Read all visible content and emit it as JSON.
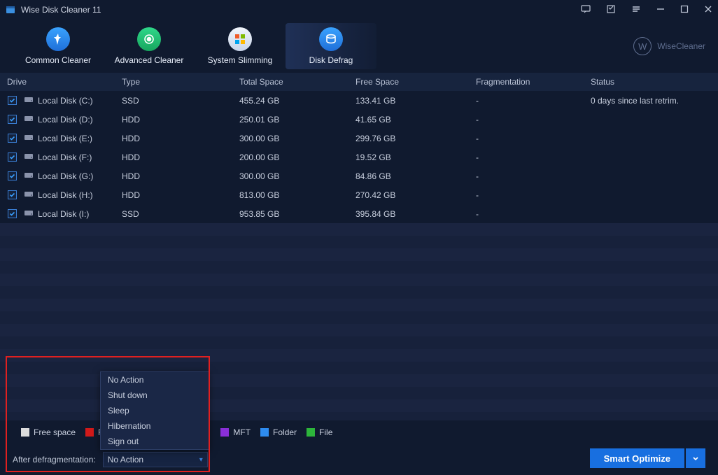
{
  "window": {
    "title": "Wise Disk Cleaner 11"
  },
  "tabs": {
    "common": "Common Cleaner",
    "advanced": "Advanced Cleaner",
    "slimming": "System Slimming",
    "defrag": "Disk Defrag"
  },
  "brand": "WiseCleaner",
  "columns": {
    "drive": "Drive",
    "type": "Type",
    "total": "Total Space",
    "free": "Free Space",
    "frag": "Fragmentation",
    "status": "Status"
  },
  "drives": [
    {
      "name": "Local Disk (C:)",
      "type": "SSD",
      "total": "455.24 GB",
      "free": "133.41 GB",
      "frag": "-",
      "status": "0 days since last retrim."
    },
    {
      "name": "Local Disk (D:)",
      "type": "HDD",
      "total": "250.01 GB",
      "free": "41.65 GB",
      "frag": "-",
      "status": ""
    },
    {
      "name": "Local Disk (E:)",
      "type": "HDD",
      "total": "300.00 GB",
      "free": "299.76 GB",
      "frag": "-",
      "status": ""
    },
    {
      "name": "Local Disk (F:)",
      "type": "HDD",
      "total": "200.00 GB",
      "free": "19.52 GB",
      "frag": "-",
      "status": ""
    },
    {
      "name": "Local Disk (G:)",
      "type": "HDD",
      "total": "300.00 GB",
      "free": "84.86 GB",
      "frag": "-",
      "status": ""
    },
    {
      "name": "Local Disk (H:)",
      "type": "HDD",
      "total": "813.00 GB",
      "free": "270.42 GB",
      "frag": "-",
      "status": ""
    },
    {
      "name": "Local Disk (I:)",
      "type": "SSD",
      "total": "953.85 GB",
      "free": "395.84 GB",
      "frag": "-",
      "status": ""
    }
  ],
  "legend": {
    "free": "Free space",
    "frag": "F",
    "mft": "MFT",
    "folder": "Folder",
    "file": "File"
  },
  "legend_colors": {
    "free": "#dcdcdc",
    "frag": "#d11a1a",
    "mft": "#8a2fd9",
    "folder": "#2e8cf0",
    "file": "#2db53b"
  },
  "dropdown": {
    "label": "After defragmentation:",
    "value": "No Action",
    "options": [
      "No Action",
      "Shut down",
      "Sleep",
      "Hibernation",
      "Sign out"
    ]
  },
  "cta": "Smart Optimize"
}
